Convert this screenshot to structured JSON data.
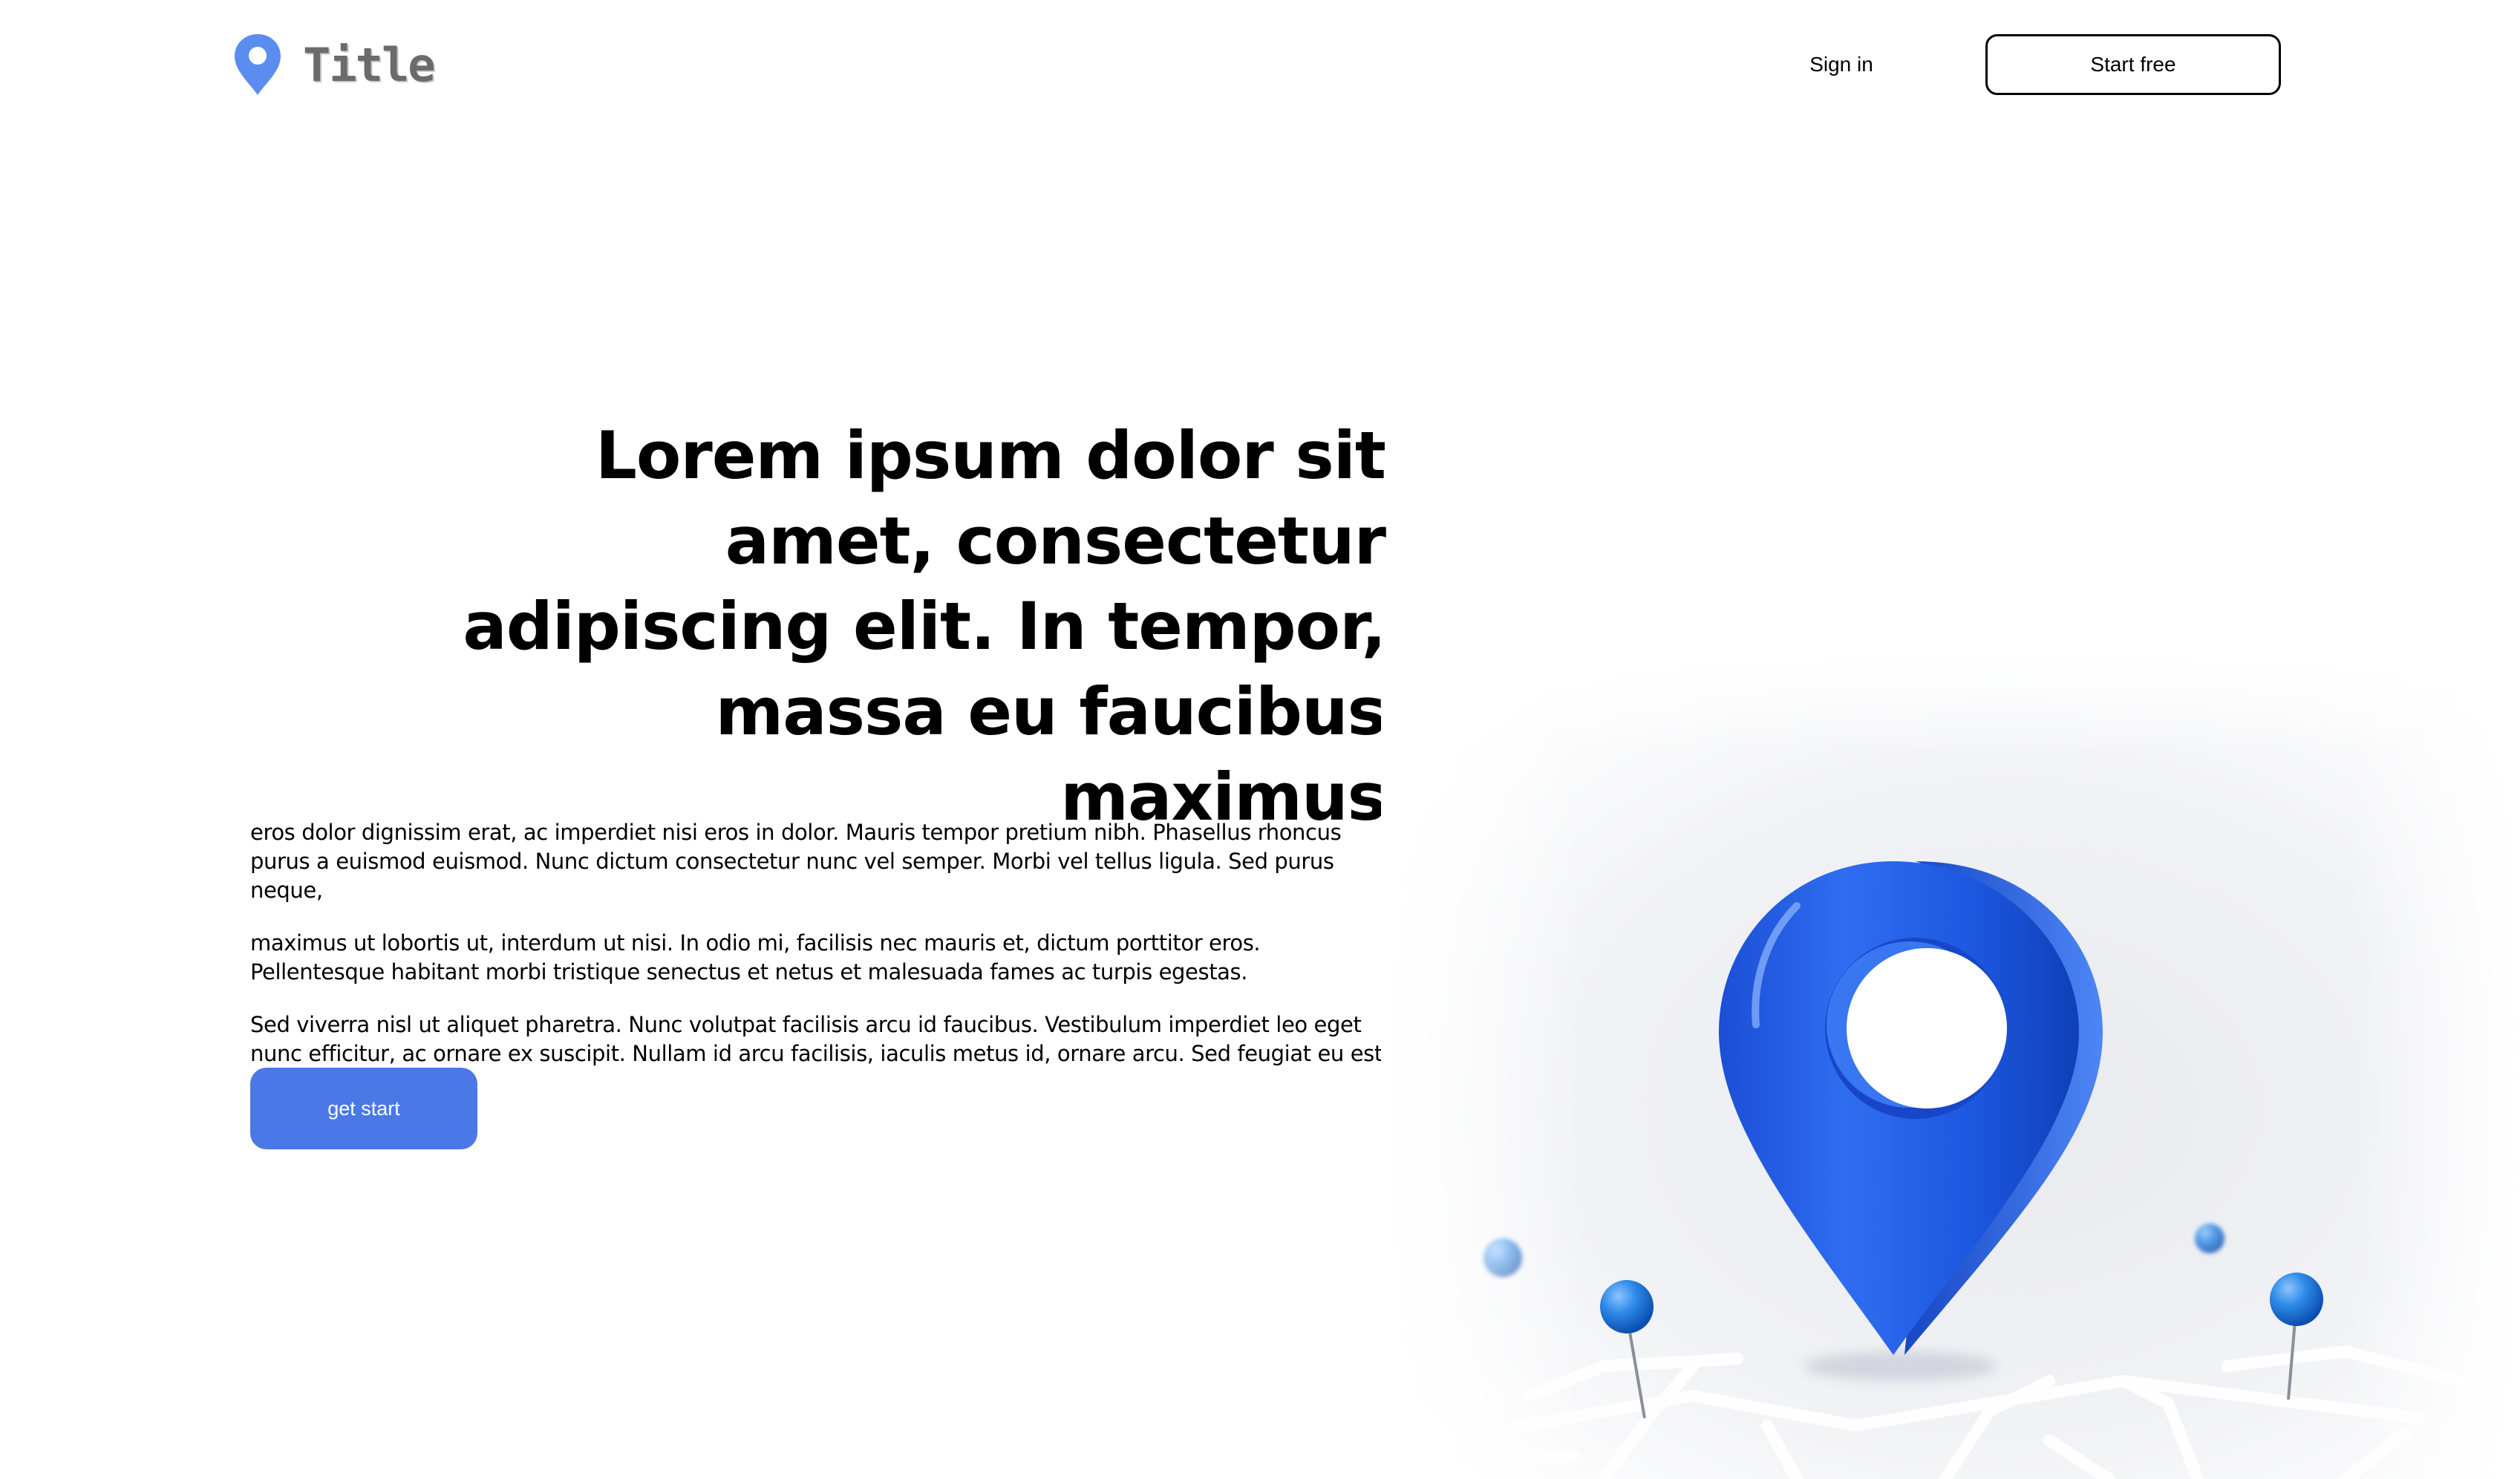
{
  "header": {
    "brand": "Title",
    "signin_label": "Sign in",
    "start_free_label": "Start free"
  },
  "hero": {
    "headline": "Lorem ipsum dolor sit amet, consectetur adipiscing elit. In tempor, massa eu faucibus maximus",
    "paragraphs": [
      "eros dolor dignissim erat, ac imperdiet nisi eros in dolor. Mauris tempor pretium nibh. Phasellus rhoncus purus a euismod euismod. Nunc dictum consectetur nunc vel semper. Morbi vel tellus ligula. Sed purus neque,",
      "maximus ut lobortis ut, interdum ut nisi. In odio mi, facilisis nec mauris et, dictum porttitor eros. Pellentesque habitant morbi tristique senectus et netus et malesuada fames ac turpis egestas.",
      "Sed viverra nisl ut aliquet pharetra. Nunc volutpat facilisis arcu id faucibus. Vestibulum imperdiet leo eget nunc efficitur, ac ornare ex suscipit. Nullam id arcu facilisis, iaculis metus id, ornare arcu. Sed feugiat eu est eget aliquet."
    ],
    "cta_label": "get start"
  },
  "illustration": {
    "name": "location-pin-on-map",
    "icon": "map-pin-icon"
  },
  "colors": {
    "accent": "#4a78e6",
    "pin_blue": "#1f5ee8",
    "logo_pin": "#5b8def"
  }
}
